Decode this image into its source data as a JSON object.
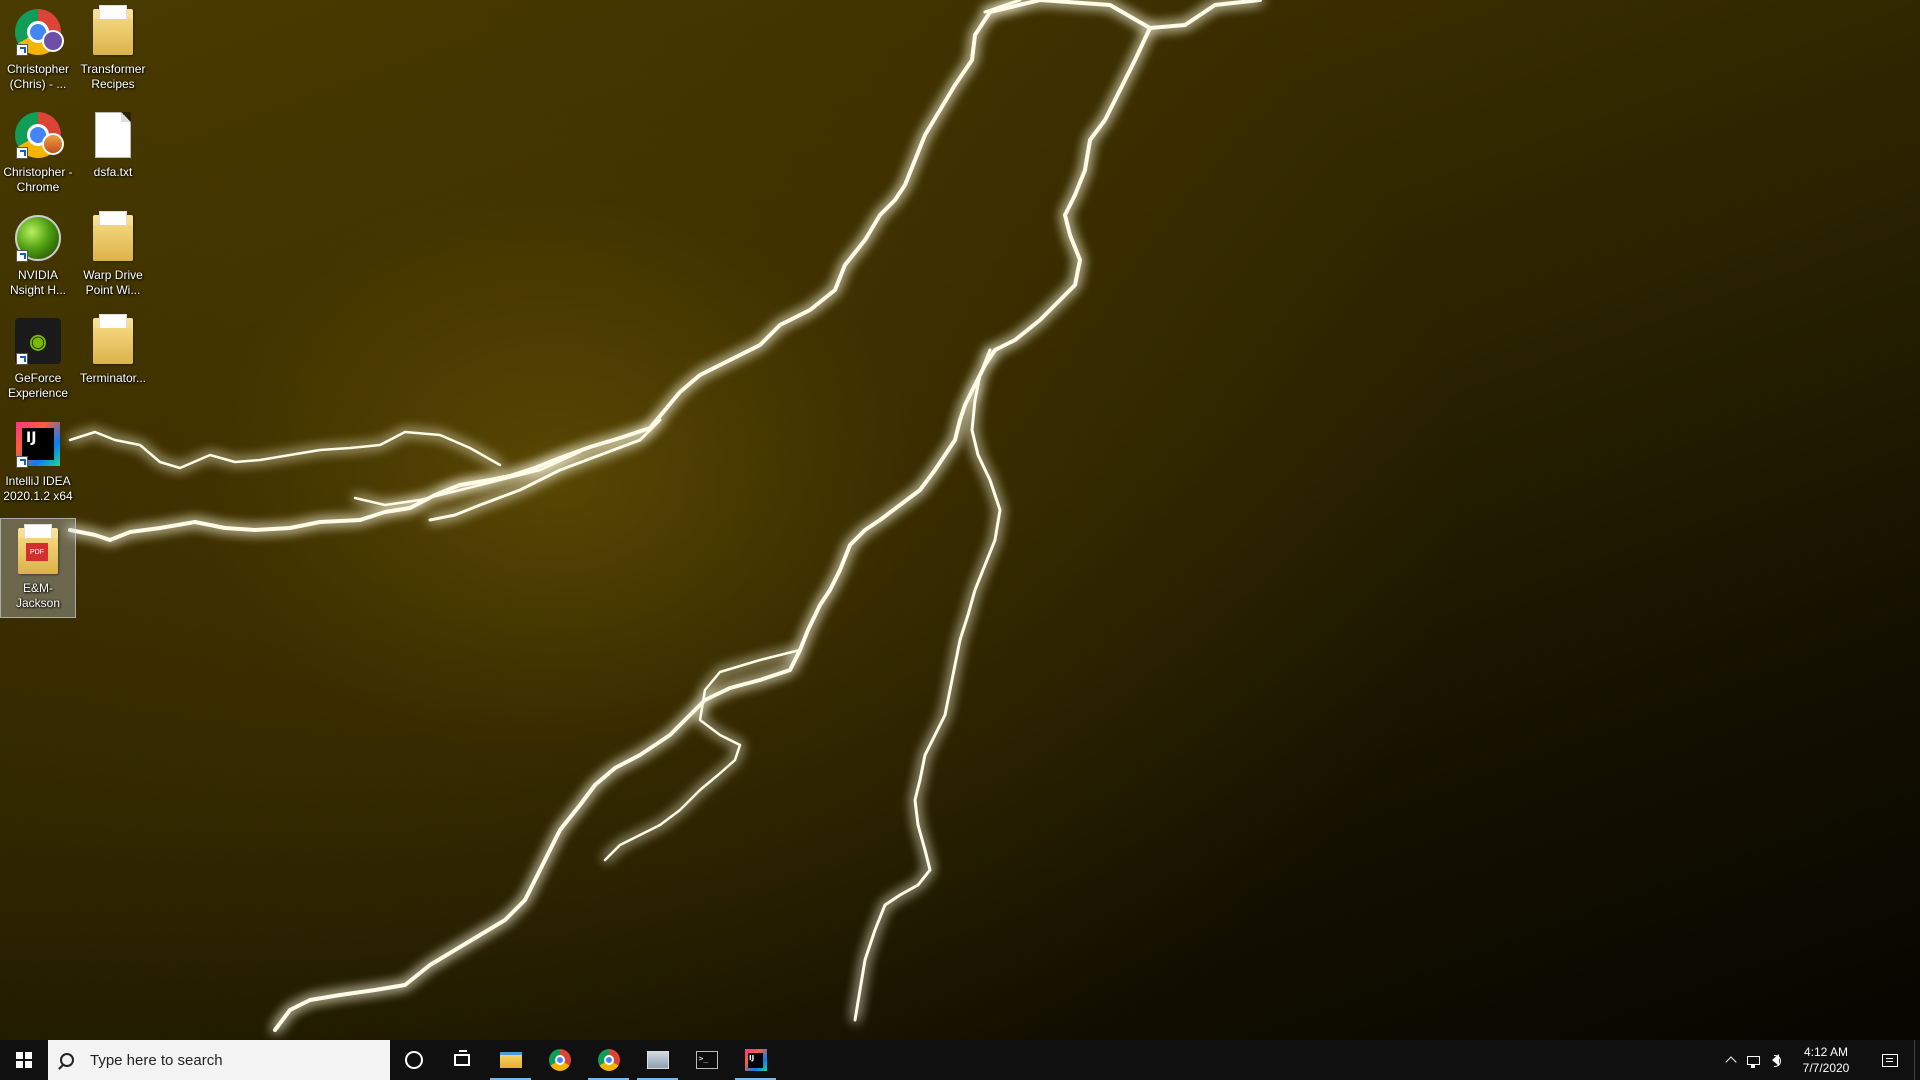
{
  "desktop": {
    "wallpaper": "yellow-lightning",
    "icons": [
      {
        "label": "Christopher (Chris) - ...",
        "icon": "chrome-profile-icon",
        "shortcut": true
      },
      {
        "label": "Transformer Recipes",
        "icon": "folder-icon",
        "shortcut": false
      },
      {
        "label": "Christopher - Chrome",
        "icon": "chrome-profile-icon",
        "shortcut": true
      },
      {
        "label": "dsfa.txt",
        "icon": "text-file-icon",
        "shortcut": false
      },
      {
        "label": "NVIDIA Nsight H...",
        "icon": "nvidia-nsight-icon",
        "shortcut": true
      },
      {
        "label": "Warp Drive Point Wi...",
        "icon": "folder-icon",
        "shortcut": false
      },
      {
        "label": "GeForce Experience",
        "icon": "geforce-icon",
        "shortcut": true
      },
      {
        "label": "Terminator...",
        "icon": "folder-icon",
        "shortcut": false
      },
      {
        "label": "IntelliJ IDEA 2020.1.2 x64",
        "icon": "intellij-icon",
        "shortcut": true
      },
      {
        "label": "E&M-Jackson",
        "icon": "pdf-folder-icon",
        "shortcut": false,
        "selected": true
      }
    ]
  },
  "taskbar": {
    "search_placeholder": "Type here to search",
    "pinned_apps": [
      {
        "name": "file-explorer",
        "active": true
      },
      {
        "name": "chrome",
        "active": false
      },
      {
        "name": "chrome-profile",
        "active": true
      },
      {
        "name": "remote-desktop",
        "active": true
      },
      {
        "name": "terminal",
        "active": false
      },
      {
        "name": "intellij",
        "active": true
      }
    ],
    "clock": {
      "time": "4:12 AM",
      "date": "7/7/2020"
    }
  },
  "colors": {
    "accent_underline": "#76b9ed",
    "taskbar_bg": "#101010",
    "lightning": "#fffbe0"
  }
}
